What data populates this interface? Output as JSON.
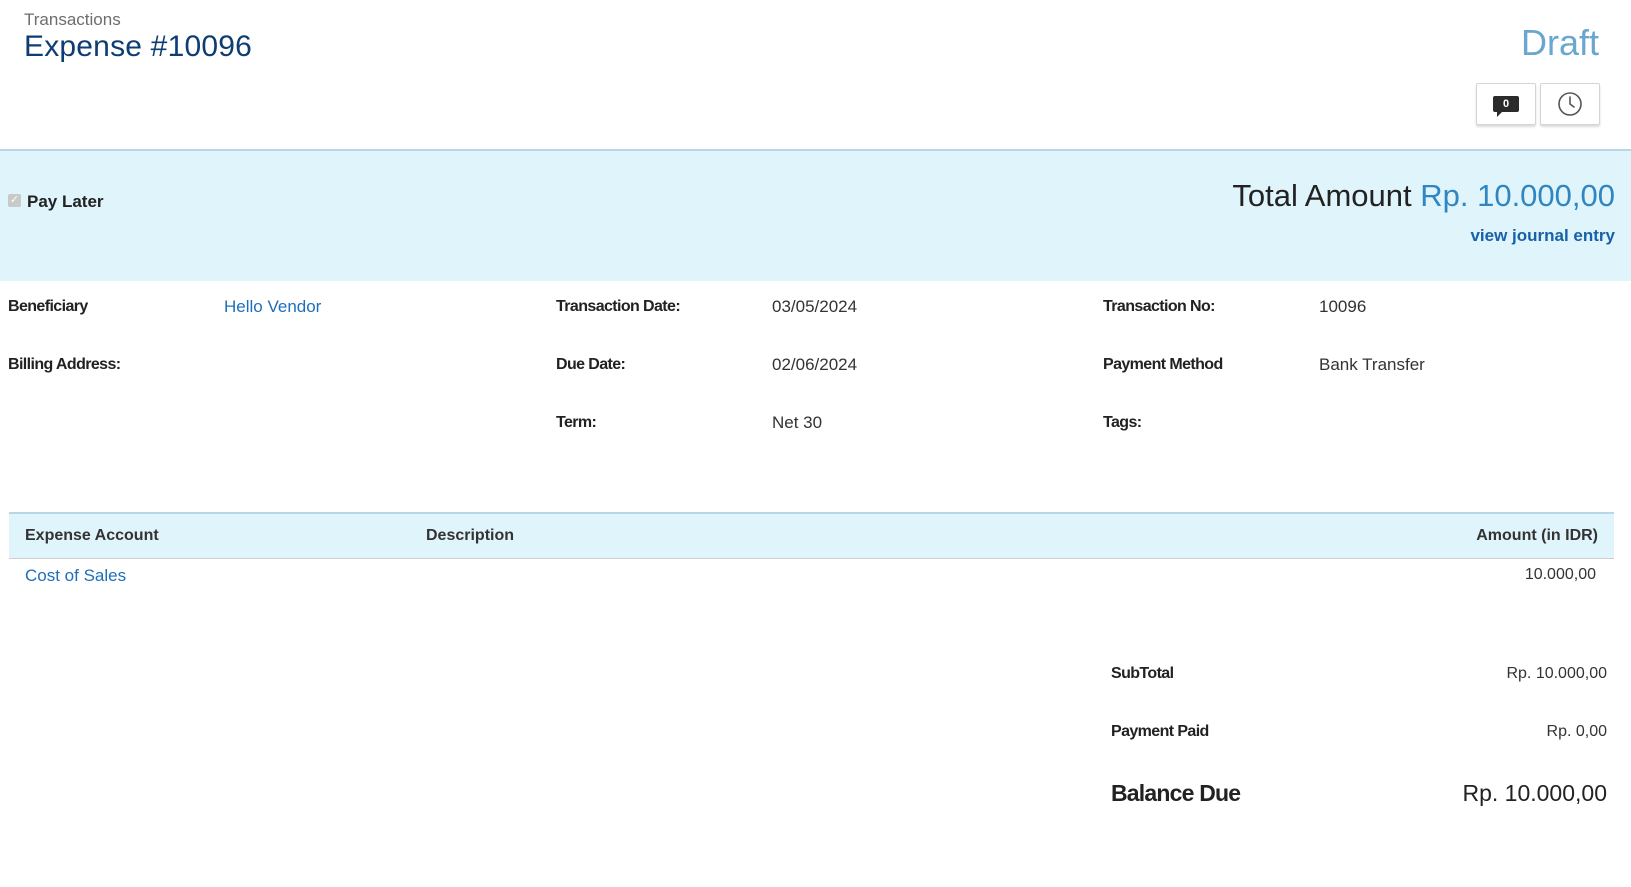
{
  "header": {
    "breadcrumb": "Transactions",
    "title": "Expense #10096",
    "status": "Draft",
    "comment_count": "0",
    "comment_icon": "comment-icon",
    "history_icon": "clock-icon"
  },
  "summary": {
    "pay_later_label": "Pay Later",
    "pay_later_checked": true,
    "total_label": "Total Amount",
    "total_amount": "Rp. 10.000,00",
    "journal_link": "view journal entry"
  },
  "details": {
    "beneficiary_label": "Beneficiary",
    "beneficiary_value": "Hello Vendor",
    "billing_address_label": "Billing Address:",
    "transaction_date_label": "Transaction Date:",
    "transaction_date_value": "03/05/2024",
    "due_date_label": "Due Date:",
    "due_date_value": "02/06/2024",
    "term_label": "Term:",
    "term_value": "Net 30",
    "transaction_no_label": "Transaction No:",
    "transaction_no_value": "10096",
    "payment_method_label": "Payment Method",
    "payment_method_value": "Bank Transfer",
    "tags_label": "Tags:"
  },
  "table": {
    "columns": [
      "Expense Account",
      "Description",
      "Amount (in IDR)"
    ],
    "rows": [
      {
        "account": "Cost of Sales",
        "description": "",
        "amount": "10.000,00"
      }
    ]
  },
  "totals": {
    "subtotal_label": "SubTotal",
    "subtotal_value": "Rp. 10.000,00",
    "payment_paid_label": "Payment Paid",
    "payment_paid_value": "Rp. 0,00",
    "balance_due_label": "Balance Due",
    "balance_due_value": "Rp. 10.000,00"
  },
  "colors": {
    "title": "#0d3d73",
    "status": "#6aa7cf",
    "band_bg": "#e0f4fc",
    "link": "#1e6fb8",
    "amount_accent": "#2f86c1"
  }
}
